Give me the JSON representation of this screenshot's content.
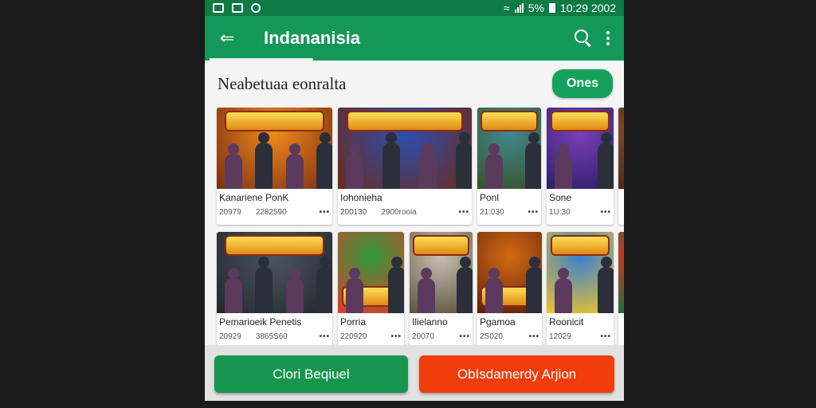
{
  "status": {
    "battery": "5%",
    "time": "10:29 2002"
  },
  "app_bar": {
    "title": "Indananisia"
  },
  "section": {
    "title": "Neabetuaa eonralta",
    "action_label": "Ones"
  },
  "row1": [
    {
      "name": "Kanariene PonK",
      "meta1": "20979",
      "meta2": "2282590",
      "art": [
        "#f08a1c",
        "#7a2d12"
      ]
    },
    {
      "name": "Iohonieha",
      "meta1": "200130",
      "meta2": "2900rooia",
      "art": [
        "#2b4fb3",
        "#6b2a1b"
      ]
    },
    {
      "name": "Ponl",
      "meta1": "21:030",
      "meta2": "",
      "art": [
        "#3f8a8f",
        "#39512c"
      ]
    },
    {
      "name": "Sone",
      "meta1": "1U:30",
      "meta2": "",
      "art": [
        "#7d3fb8",
        "#2b1f6b"
      ]
    },
    {
      "name": "",
      "meta1": "",
      "meta2": "",
      "art": [
        "#7b4a2b",
        "#4f2a1a"
      ]
    }
  ],
  "row2": [
    {
      "name": "Pemarioeik Penetis",
      "meta1": "20929",
      "meta2": "3865S60",
      "art": [
        "#4b5560",
        "#22272c"
      ]
    },
    {
      "name": "Porria",
      "meta1": "220920",
      "meta2": "",
      "art": [
        "#2f9b3b",
        "#e13a2a"
      ]
    },
    {
      "name": "Ilielanno",
      "meta1": "20070",
      "meta2": "",
      "art": [
        "#c8c0b2",
        "#5c5040"
      ]
    },
    {
      "name": "Pgamoa",
      "meta1": "2S020",
      "meta2": "",
      "art": [
        "#d46a12",
        "#5a1f0c"
      ]
    },
    {
      "name": "Roonicit",
      "meta1": "12029",
      "meta2": "",
      "art": [
        "#3a7fd1",
        "#f0c52a"
      ]
    },
    {
      "name": "",
      "meta1": "",
      "meta2": "",
      "art": [
        "#c0392b",
        "#2a6b3a"
      ]
    }
  ],
  "bottom": {
    "primary_label": "Clori Beqiuel",
    "secondary_label": "ObIsdamerdy Arjion"
  },
  "colors": {
    "app_bar": "#14985a",
    "status_bar": "#0e7a45",
    "green_button": "#17964f",
    "red_button": "#f13d0c"
  }
}
